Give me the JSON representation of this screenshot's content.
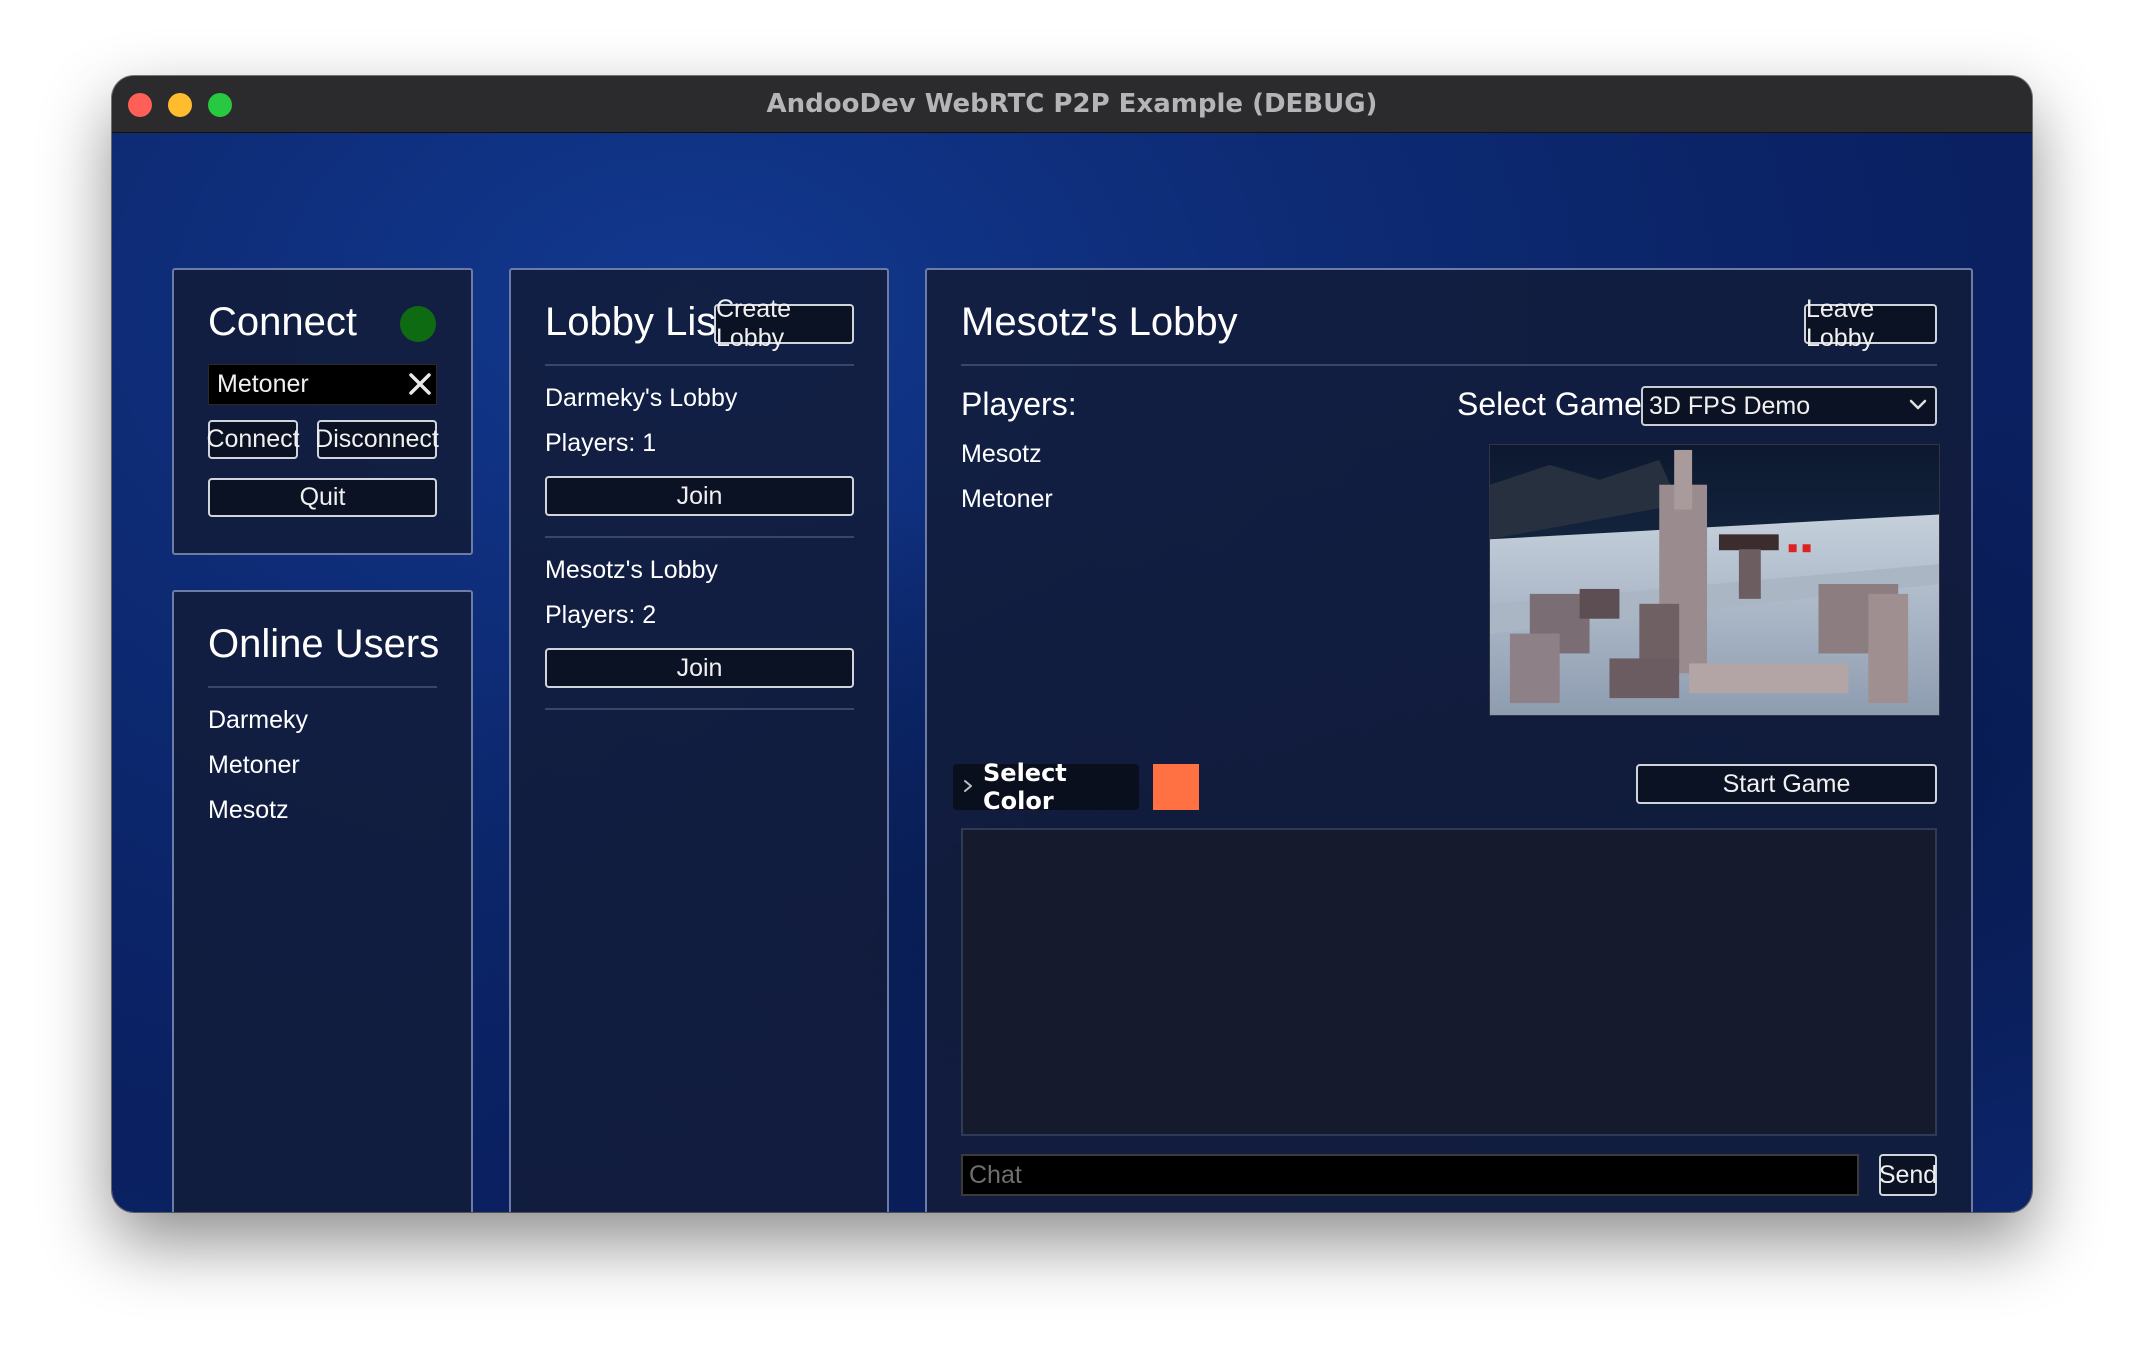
{
  "window": {
    "title": "AndooDev WebRTC P2P Example (DEBUG)"
  },
  "connect_panel": {
    "title": "Connect",
    "status_color": "#0f6b12",
    "name_value": "Metoner",
    "connect_label": "Connect",
    "disconnect_label": "Disconnect",
    "quit_label": "Quit"
  },
  "online_users": {
    "title": "Online Users",
    "users": [
      "Darmeky",
      "Metoner",
      "Mesotz"
    ]
  },
  "lobby_list": {
    "title": "Lobby List",
    "create_label": "Create Lobby",
    "lobbies": [
      {
        "name": "Darmeky's Lobby",
        "players": "Players: 1",
        "join_label": "Join"
      },
      {
        "name": "Mesotz's Lobby",
        "players": "Players: 2",
        "join_label": "Join"
      }
    ]
  },
  "lobby": {
    "title": "Mesotz's Lobby",
    "leave_label": "Leave Lobby",
    "players_heading": "Players:",
    "players": [
      "Mesotz",
      "Metoner"
    ],
    "select_game_label": "Select Game:",
    "selected_game": "3D FPS Demo",
    "select_color_label": "Select Color",
    "selected_color": "#ff7043",
    "start_label": "Start Game",
    "chat_placeholder": "Chat",
    "send_label": "Send"
  }
}
